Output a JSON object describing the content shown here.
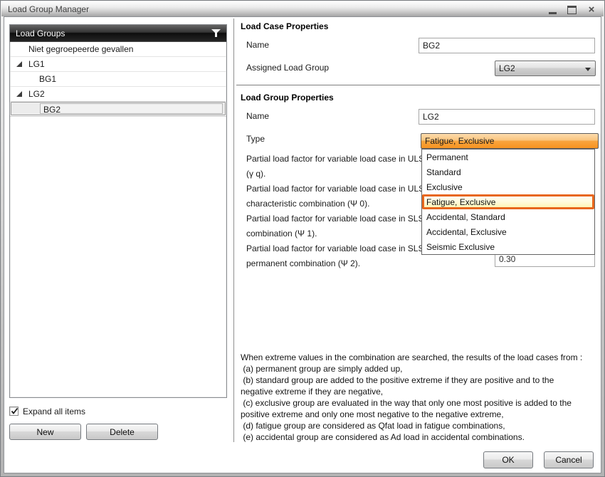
{
  "window": {
    "title": "Load Group Manager",
    "close_glyph": "×"
  },
  "left_panel": {
    "header": "Load Groups",
    "filter_icon": "funnel",
    "items": [
      {
        "label": "Niet gegroepeerde gevallen"
      },
      {
        "label": "LG1"
      },
      {
        "label": "BG1"
      },
      {
        "label": "LG2"
      },
      {
        "label": "BG2"
      }
    ],
    "expand_all_label": "Expand all items",
    "expand_all_checked": true,
    "new_button": "New",
    "delete_button": "Delete"
  },
  "load_case_properties": {
    "section_title": "Load Case Properties",
    "name_label": "Name",
    "name_value": "BG2",
    "assigned_group_label": "Assigned Load Group",
    "assigned_group_value": "LG2"
  },
  "load_group_properties": {
    "section_title": "Load Group Properties",
    "name_label": "Name",
    "name_value": "LG2",
    "type_label": "Type",
    "type_value": "Fatigue, Exclusive",
    "type_options": [
      {
        "label": "Permanent"
      },
      {
        "label": "Standard"
      },
      {
        "label": "Exclusive"
      },
      {
        "label": "Fatigue, Exclusive"
      },
      {
        "label": "Accidental, Standard"
      },
      {
        "label": "Accidental, Exclusive"
      },
      {
        "label": "Seismic Exclusive"
      }
    ],
    "highlighted_option": "Fatigue, Exclusive",
    "factors": [
      {
        "line1": "Partial load factor for variable load case in ULS",
        "line2": "(γ q)."
      },
      {
        "line1": "Partial load factor for variable load case in ULS",
        "line2": "characteristic combination (Ψ 0)."
      },
      {
        "line1": "Partial load factor for variable load case in SLS",
        "line2": "combination (Ψ 1)."
      },
      {
        "line1": "Partial load factor for variable load case in SLS",
        "line2": "permanent combination (Ψ 2)."
      }
    ],
    "visible_factor_value": "0.30"
  },
  "description": {
    "lines": [
      "When extreme values in the combination are searched, the results of the load cases from :",
      " (a) permanent group are simply added up,",
      " (b) standard group are added to the positive extreme if they are positive and to the",
      "negative extreme if they are negative,",
      " (c) exclusive group are evaluated in the way that only one most positive is added to the",
      "positive extreme and only one most negative to the negative extreme,",
      " (d) fatigue group are considered as Qfat load in fatigue combinations,",
      " (e) accidental group are considered as Ad load in accidental combinations."
    ]
  },
  "footer": {
    "ok_button": "OK",
    "cancel_button": "Cancel"
  },
  "colors": {
    "accent_orange": "#F7941E",
    "highlight_border": "#E8671D",
    "highlight_bg": "#FFFAD1",
    "tree_header_bg": "#1C1C1C"
  }
}
